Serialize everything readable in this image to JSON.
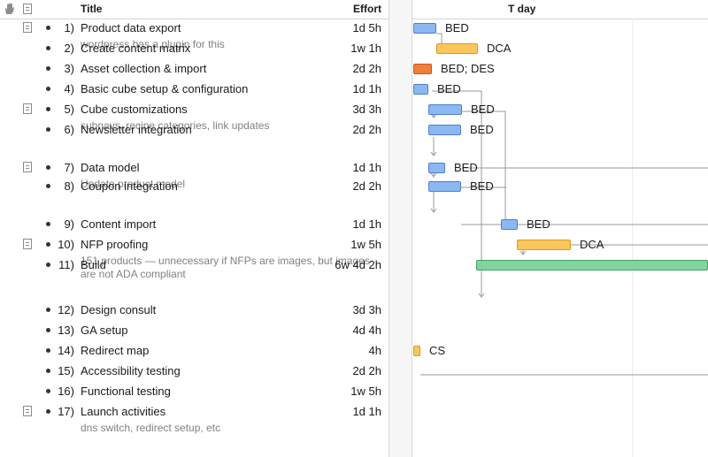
{
  "header": {
    "title_label": "Title",
    "effort_label": "Effort",
    "tday_label": "T day"
  },
  "icons": {
    "hand": "hand-icon",
    "note": "note-icon"
  },
  "tasks": [
    {
      "num": "1)",
      "title": "Product data export",
      "effort": "1d 5h",
      "note": "wordpress has a plugin for this",
      "has_note_icon": true
    },
    {
      "num": "2)",
      "title": "Create content matrix",
      "effort": "1w 1h",
      "note": "",
      "has_note_icon": false
    },
    {
      "num": "3)",
      "title": "Asset collection & import",
      "effort": "2d 2h",
      "note": "",
      "has_note_icon": false
    },
    {
      "num": "4)",
      "title": "Basic cube setup & configuration",
      "effort": "1d 1h",
      "note": "",
      "has_note_icon": false
    },
    {
      "num": "5)",
      "title": "Cube customizations",
      "effort": "3d 3h",
      "note": "subnavs, recipe categories, link updates",
      "has_note_icon": true
    },
    {
      "num": "6)",
      "title": "Newsletter integration",
      "effort": "2d 2h",
      "note": "",
      "has_note_icon": false
    },
    {
      "num": "7)",
      "title": "Data model",
      "effort": "1d 1h",
      "note": "Update product model",
      "has_note_icon": true
    },
    {
      "num": "8)",
      "title": "Coupon integration",
      "effort": "2d 2h",
      "note": "",
      "has_note_icon": false
    },
    {
      "num": "9)",
      "title": "Content import",
      "effort": "1d 1h",
      "note": "",
      "has_note_icon": false
    },
    {
      "num": "10)",
      "title": "NFP proofing",
      "effort": "1w 5h",
      "note": "151 products — unnecessary if NFPs are images, but images are not ADA compliant",
      "has_note_icon": true
    },
    {
      "num": "11)",
      "title": "Build",
      "effort": "6w 4d 2h",
      "note": "",
      "has_note_icon": false
    },
    {
      "num": "12)",
      "title": "Design consult",
      "effort": "3d 3h",
      "note": "",
      "has_note_icon": false
    },
    {
      "num": "13)",
      "title": "GA setup",
      "effort": "4d 4h",
      "note": "",
      "has_note_icon": false
    },
    {
      "num": "14)",
      "title": "Redirect map",
      "effort": "4h",
      "note": "",
      "has_note_icon": false
    },
    {
      "num": "15)",
      "title": "Accessibility testing",
      "effort": "2d 2h",
      "note": "",
      "has_note_icon": false
    },
    {
      "num": "16)",
      "title": "Functional testing",
      "effort": "1w 5h",
      "note": "",
      "has_note_icon": false
    },
    {
      "num": "17)",
      "title": "Launch activities",
      "effort": "1d 1h",
      "note": "dns switch, redirect setup, etc",
      "has_note_icon": true
    }
  ],
  "gantt": {
    "colors": {
      "blue": "#8bb8f2",
      "yellow": "#fbc65a",
      "orange": "#f07f3c",
      "green": "#82d39c"
    },
    "bars": [
      {
        "task": 1,
        "color": "blue",
        "resource": "BED"
      },
      {
        "task": 2,
        "color": "yellow",
        "resource": "DCA"
      },
      {
        "task": 3,
        "color": "orange",
        "resource": "BED; DES"
      },
      {
        "task": 4,
        "color": "blue",
        "resource": "BED"
      },
      {
        "task": 5,
        "color": "blue",
        "resource": "BED"
      },
      {
        "task": 6,
        "color": "blue",
        "resource": "BED"
      },
      {
        "task": 7,
        "color": "blue",
        "resource": "BED"
      },
      {
        "task": 8,
        "color": "blue",
        "resource": "BED"
      },
      {
        "task": 9,
        "color": "blue",
        "resource": "BED"
      },
      {
        "task": 10,
        "color": "yellow",
        "resource": "DCA"
      },
      {
        "task": 11,
        "color": "green",
        "resource": ""
      },
      {
        "task": 14,
        "color": "yellow",
        "resource": "CS"
      }
    ]
  }
}
